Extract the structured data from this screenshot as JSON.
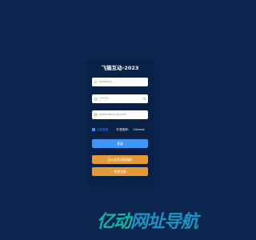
{
  "app": {
    "title": "飞猫互动-2023"
  },
  "form": {
    "username_value": "abdyeng",
    "password_mask": "••••••",
    "url_value": "www.abdyeng.com"
  },
  "options": {
    "remember_label": "记住密码",
    "language_label": "外语选择：",
    "language_value": "Chinese"
  },
  "buttons": {
    "login_label": "登录",
    "secondary_label": "加入会员领取福利",
    "tertiary_label": "免费注册"
  },
  "watermark": {
    "part1": "亿动",
    "part2": "网址导航"
  },
  "colors": {
    "background": "#0c2650",
    "panel": "#0a2147",
    "primary": "#3e95f8",
    "accent_orange": "#e29b3a",
    "watermark_teal": "#13b6a2",
    "watermark_blue": "#1e93c2"
  },
  "icons": {
    "username": "user-icon",
    "password": "lock-icon",
    "password_toggle": "eye-icon",
    "url": "globe-icon"
  }
}
